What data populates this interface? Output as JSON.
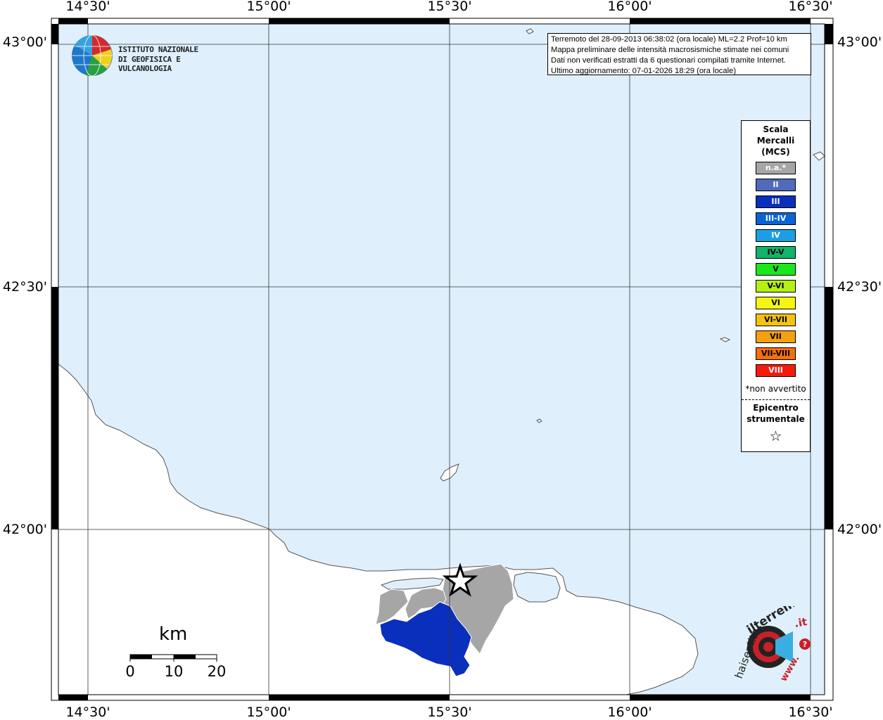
{
  "map": {
    "lon_labels": [
      "14°30'",
      "15°00'",
      "15°30'",
      "16°00'",
      "16°30'"
    ],
    "lat_labels": [
      "43°00'",
      "42°30'",
      "42°00'"
    ],
    "colors": {
      "sea": "#dff0fc",
      "land": "#ffffff",
      "coast": "#555555",
      "na_fill": "#a6a6a6",
      "iii_fill": "#0a2fbd"
    },
    "epicenter_symbol": "star-outline"
  },
  "info": {
    "line1": "Terremoto del 28-09-2013 06:38:02 (ora locale) ML=2.2 Prof=10 km",
    "line2": "Mappa preliminare delle intensità macrosismiche stimate nei comuni",
    "line3": "Dati non verificati estratti da 6 questionari compilati tramite Internet.",
    "line4": "Ultimo aggiornamento: 07-01-2026 18:29 (ora locale)"
  },
  "logo": {
    "line1": "ISTITUTO NAZIONALE",
    "line2": "DI GEOFISICA E VULCANOLOGIA"
  },
  "legend": {
    "title1": "Scala",
    "title2": "Mercalli",
    "title3": "(MCS)",
    "items": [
      {
        "label": "n.a.*",
        "color": "#a6a6a6",
        "text": "#ffffff"
      },
      {
        "label": "II",
        "color": "#4f6bb9",
        "text": "#ffffff"
      },
      {
        "label": "III",
        "color": "#0a2fbd",
        "text": "#ffffff"
      },
      {
        "label": "III-IV",
        "color": "#0a63d6",
        "text": "#ffffff"
      },
      {
        "label": "IV",
        "color": "#1b9ee6",
        "text": "#ffffff"
      },
      {
        "label": "IV-V",
        "color": "#12b36a",
        "text": "#000000"
      },
      {
        "label": "V",
        "color": "#1be61b",
        "text": "#000000"
      },
      {
        "label": "V-VI",
        "color": "#b3f016",
        "text": "#000000"
      },
      {
        "label": "VI",
        "color": "#f5f50f",
        "text": "#000000"
      },
      {
        "label": "VI-VII",
        "color": "#f5c20f",
        "text": "#000000"
      },
      {
        "label": "VII",
        "color": "#f5a00f",
        "text": "#000000"
      },
      {
        "label": "VII-VIII",
        "color": "#f56e0f",
        "text": "#000000"
      },
      {
        "label": "VIII",
        "color": "#f51b0f",
        "text": "#ffffff"
      }
    ],
    "note": "*non avvertito",
    "epi1": "Epicentro",
    "epi2": "strumentale",
    "epi_symbol": "☆"
  },
  "scale": {
    "unit": "km",
    "ticks": [
      "0",
      "10",
      "20"
    ]
  },
  "hst": {
    "text1": "haisentito",
    "text2": "ilterremoto",
    "text3": ".it",
    "text4": "www."
  }
}
